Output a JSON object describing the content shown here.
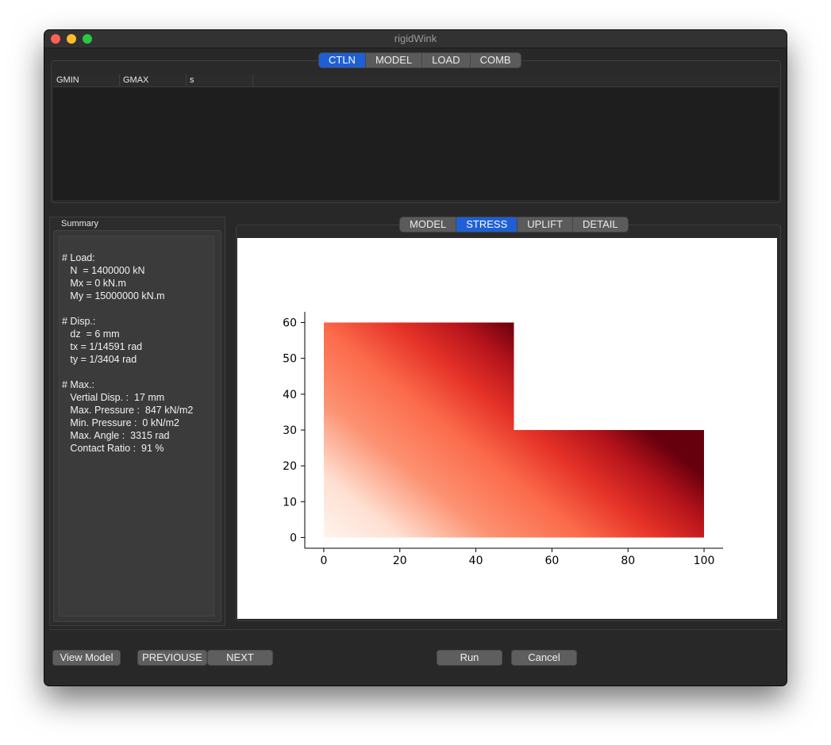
{
  "window": {
    "title": "rigidWink"
  },
  "top_tabs": [
    {
      "label": "CTLN",
      "active": true
    },
    {
      "label": "MODEL",
      "active": false
    },
    {
      "label": "LOAD",
      "active": false
    },
    {
      "label": "COMB",
      "active": false
    }
  ],
  "grid": {
    "columns": [
      "GMIN",
      "GMAX",
      "s"
    ]
  },
  "summary": {
    "title": "Summary",
    "lines": [
      "# Load:",
      "   N  = 1400000 kN",
      "   Mx = 0 kN.m",
      "   My = 15000000 kN.m",
      "",
      "# Disp.:",
      "   dz  = 6 mm",
      "   tx = 1/14591 rad",
      "   ty = 1/3404 rad",
      "",
      "# Max.:",
      "   Vertial Disp. :  17 mm",
      "   Max. Pressure :  847 kN/m2",
      "   Min. Pressure :  0 kN/m2",
      "   Max. Angle :  3315 rad",
      "   Contact Ratio :  91 %"
    ]
  },
  "plot_tabs": [
    {
      "label": "MODEL",
      "active": false
    },
    {
      "label": "STRESS",
      "active": true
    },
    {
      "label": "UPLIFT",
      "active": false
    },
    {
      "label": "DETAIL",
      "active": false
    }
  ],
  "chart_data": {
    "type": "heatmap",
    "title": "",
    "xlabel": "",
    "ylabel": "",
    "xlim": [
      -5,
      105
    ],
    "ylim": [
      -3,
      63
    ],
    "xticks": [
      "0",
      "20",
      "40",
      "60",
      "80",
      "100"
    ],
    "yticks": [
      "0",
      "10",
      "20",
      "30",
      "40",
      "50",
      "60"
    ],
    "colormap": "Reds",
    "regions": [
      {
        "name": "upper-left block",
        "x": [
          0,
          50
        ],
        "y": [
          0,
          60
        ]
      },
      {
        "name": "lower-right block",
        "x": [
          50,
          100
        ],
        "y": [
          0,
          30
        ]
      }
    ],
    "color_scale": {
      "min_color": "#fff5f0",
      "mid_color": "#f03b20",
      "max_color": "#67000d"
    },
    "grid": false
  },
  "buttons": {
    "view_model": "View Model",
    "previous": "PREVIOUSE",
    "next": "NEXT",
    "run": "Run",
    "cancel": "Cancel"
  }
}
